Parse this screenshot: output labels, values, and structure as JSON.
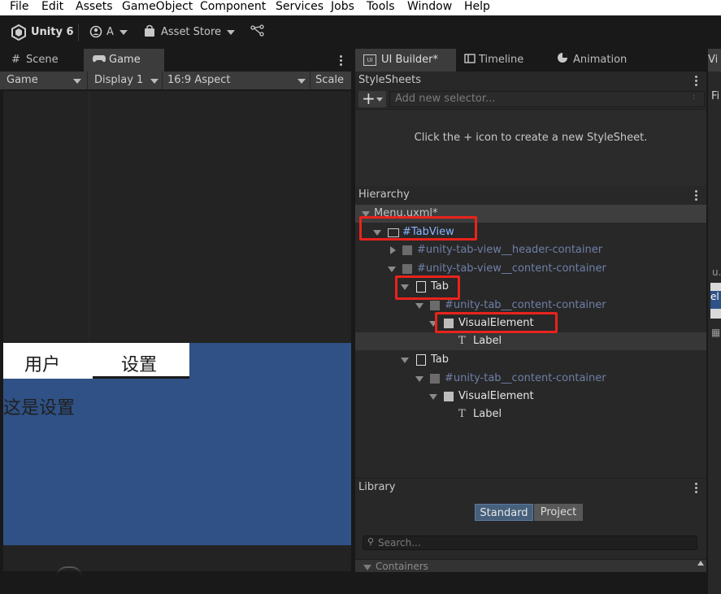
{
  "menu": [
    "File",
    "Edit",
    "Assets",
    "GameObject",
    "Component",
    "Services",
    "Jobs",
    "Tools",
    "Window",
    "Help"
  ],
  "toolbar": {
    "unity_label": "Unity 6",
    "account_label": "A",
    "asset_store_label": "Asset Store"
  },
  "left_tabs": [
    {
      "label": "Scene"
    },
    {
      "label": "Game"
    }
  ],
  "game_toolbar": {
    "display_mode": "Game",
    "display": "Display 1",
    "aspect": "16:9 Aspect",
    "scale_label": "Scale"
  },
  "game_ui": {
    "tab1": "用户",
    "tab2": "设置",
    "content": "这是设置"
  },
  "right_tabs": [
    {
      "label": "UI Builder*"
    },
    {
      "label": "Timeline"
    },
    {
      "label": "Animation"
    }
  ],
  "stylesheets": {
    "title": "StyleSheets",
    "add_placeholder": "Add new selector...",
    "hint": "Click the + icon to create a new StyleSheet."
  },
  "hierarchy": {
    "title": "Hierarchy",
    "root": "Menu.uxml*",
    "rows": [
      {
        "label": "#TabView"
      },
      {
        "label": "#unity-tab-view__header-container"
      },
      {
        "label": "#unity-tab-view__content-container"
      },
      {
        "label": "Tab"
      },
      {
        "label": "#unity-tab__content-container"
      },
      {
        "label": "VisualElement"
      },
      {
        "label": "Label"
      },
      {
        "label": "Tab"
      },
      {
        "label": "#unity-tab__content-container"
      },
      {
        "label": "VisualElement"
      },
      {
        "label": "Label"
      }
    ]
  },
  "library": {
    "title": "Library",
    "tab_standard": "Standard",
    "tab_project": "Project",
    "search_placeholder": "Search...",
    "section": "Containers"
  },
  "far_right": {
    "tab": "Vi",
    "item1": "Fi",
    "item2": "u.",
    "item3": "el"
  }
}
